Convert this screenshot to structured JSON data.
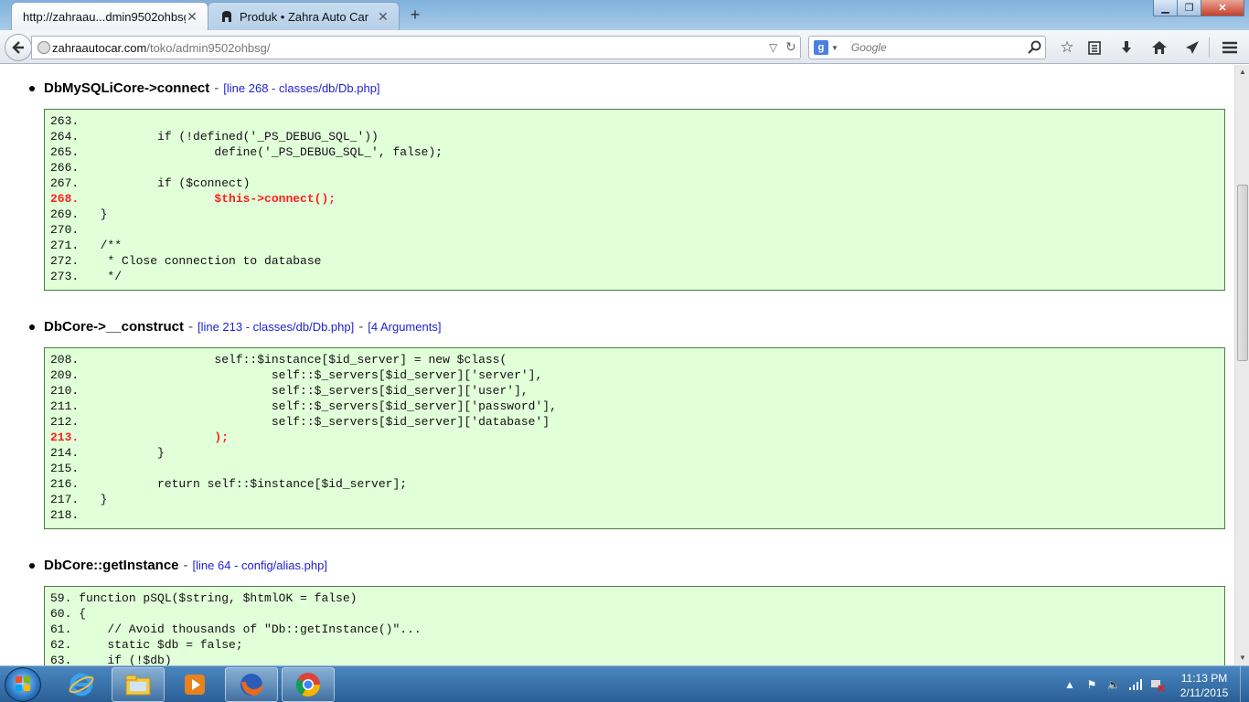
{
  "browser": {
    "tabs": [
      {
        "label": "http://zahraau...dmin9502ohbsg/",
        "active": true
      },
      {
        "label": "Produk • Zahra Auto Car",
        "active": false
      }
    ],
    "url": {
      "host": "zahraautocar.com",
      "path": "/toko/admin9502ohbsg/"
    },
    "search": {
      "engine": "g",
      "placeholder": "Google"
    }
  },
  "traces": [
    {
      "function": "DbMySQLiCore->connect",
      "location": "[line 268 - classes/db/Db.php]",
      "arguments": "",
      "lines": [
        {
          "text": "263.",
          "hl": false
        },
        {
          "text": "264.           if (!defined('_PS_DEBUG_SQL_'))",
          "hl": false
        },
        {
          "text": "265.                   define('_PS_DEBUG_SQL_', false);",
          "hl": false
        },
        {
          "text": "266.",
          "hl": false
        },
        {
          "text": "267.           if ($connect)",
          "hl": false
        },
        {
          "text": "268.                   $this->connect();",
          "hl": true
        },
        {
          "text": "269.   }",
          "hl": false
        },
        {
          "text": "270.",
          "hl": false
        },
        {
          "text": "271.   /**",
          "hl": false
        },
        {
          "text": "272.    * Close connection to database",
          "hl": false
        },
        {
          "text": "273.    */",
          "hl": false
        }
      ]
    },
    {
      "function": "DbCore->__construct",
      "location": "[line 213 - classes/db/Db.php]",
      "arguments": "[4 Arguments]",
      "lines": [
        {
          "text": "208.                   self::$instance[$id_server] = new $class(",
          "hl": false
        },
        {
          "text": "209.                           self::$_servers[$id_server]['server'],",
          "hl": false
        },
        {
          "text": "210.                           self::$_servers[$id_server]['user'],",
          "hl": false
        },
        {
          "text": "211.                           self::$_servers[$id_server]['password'],",
          "hl": false
        },
        {
          "text": "212.                           self::$_servers[$id_server]['database']",
          "hl": false
        },
        {
          "text": "213.                   );",
          "hl": true
        },
        {
          "text": "214.           }",
          "hl": false
        },
        {
          "text": "215.",
          "hl": false
        },
        {
          "text": "216.           return self::$instance[$id_server];",
          "hl": false
        },
        {
          "text": "217.   }",
          "hl": false
        },
        {
          "text": "218.",
          "hl": false
        }
      ]
    },
    {
      "function": "DbCore::getInstance",
      "location": "[line 64 - config/alias.php]",
      "arguments": "",
      "lines": [
        {
          "text": "59. function pSQL($string, $htmlOK = false)",
          "hl": false
        },
        {
          "text": "60. {",
          "hl": false
        },
        {
          "text": "61.     // Avoid thousands of \"Db::getInstance()\"...",
          "hl": false
        },
        {
          "text": "62.     static $db = false;",
          "hl": false
        },
        {
          "text": "63.     if (!$db)",
          "hl": false
        }
      ]
    }
  ],
  "taskbar": {
    "apps": [
      "windows-explorer-icon",
      "internet-explorer-icon",
      "file-explorer-icon",
      "media-player-icon",
      "firefox-icon",
      "chrome-icon"
    ],
    "clock": {
      "time": "11:13 PM",
      "date": "2/11/2015"
    }
  },
  "colors": {
    "code_bg": "#e1ffd9",
    "code_border": "#4c7c44",
    "highlight": "#ff1f1f",
    "link": "#2121d6"
  }
}
